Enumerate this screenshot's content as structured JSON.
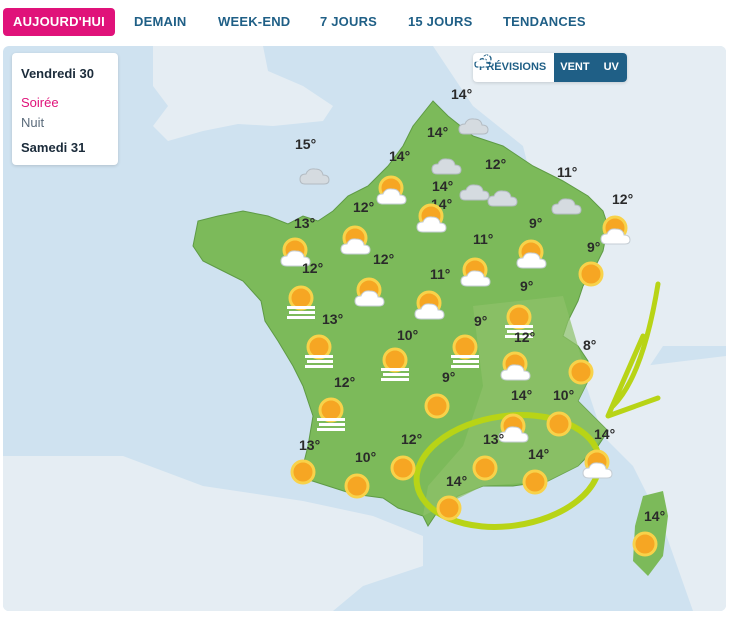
{
  "tabs": [
    {
      "label": "AUJOURD'HUI",
      "active": true
    },
    {
      "label": "DEMAIN",
      "active": false
    },
    {
      "label": "WEEK-END",
      "active": false
    },
    {
      "label": "7 JOURS",
      "active": false
    },
    {
      "label": "15 JOURS",
      "active": false
    },
    {
      "label": "TENDANCES",
      "active": false
    }
  ],
  "day_selector": {
    "day1": "Vendredi 30",
    "evening": "Soirée",
    "night": "Nuit",
    "day2": "Samedi 31"
  },
  "layers": [
    {
      "label": "PRÉVISIONS",
      "icon": "cloud-sun-icon",
      "active": false
    },
    {
      "label": "VENT",
      "icon": "wind-icon",
      "active": true
    },
    {
      "label": "UV",
      "icon": "uv-icon",
      "active": false
    }
  ],
  "colors": {
    "accent": "#e0127a",
    "nav": "#1f5f86",
    "land": "#7cba5a",
    "sea": "#cfe2f0",
    "annotation": "#b8d416"
  },
  "stations": [
    {
      "temp": "14°",
      "icon": "cloud-icon"
    },
    {
      "temp": "14°",
      "icon": "cloud-icon"
    },
    {
      "temp": "15°",
      "icon": "cloud-icon"
    },
    {
      "temp": "14°",
      "icon": "sun-cloud-icon"
    },
    {
      "temp": "12°",
      "icon": "cloud-icon"
    },
    {
      "temp": "11°",
      "icon": "cloud-icon"
    },
    {
      "temp": "14°",
      "icon": "cloud-icon"
    },
    {
      "temp": "14°",
      "icon": "sun-cloud-icon"
    },
    {
      "temp": "13°",
      "icon": "sun-cloud-icon"
    },
    {
      "temp": "12°",
      "icon": "sun-cloud-icon"
    },
    {
      "temp": "12°",
      "icon": "sun-cloud-icon"
    },
    {
      "temp": "9°",
      "icon": "sun-cloud-icon"
    },
    {
      "temp": "11°",
      "icon": "sun-cloud-icon"
    },
    {
      "temp": "9°",
      "icon": "sun-icon"
    },
    {
      "temp": "12°",
      "icon": "sun-fog-icon"
    },
    {
      "temp": "12°",
      "icon": "sun-cloud-icon"
    },
    {
      "temp": "11°",
      "icon": "sun-cloud-icon"
    },
    {
      "temp": "9°",
      "icon": "sun-fog-icon"
    },
    {
      "temp": "13°",
      "icon": "sun-fog-icon"
    },
    {
      "temp": "10°",
      "icon": "sun-fog-icon"
    },
    {
      "temp": "9°",
      "icon": "sun-fog-icon"
    },
    {
      "temp": "12°",
      "icon": "sun-cloud-icon"
    },
    {
      "temp": "8°",
      "icon": "sun-icon"
    },
    {
      "temp": "12°",
      "icon": "sun-fog-icon"
    },
    {
      "temp": "9°",
      "icon": "sun-icon"
    },
    {
      "temp": "14°",
      "icon": "sun-cloud-icon"
    },
    {
      "temp": "10°",
      "icon": "sun-icon"
    },
    {
      "temp": "13°",
      "icon": "sun-icon"
    },
    {
      "temp": "12°",
      "icon": "sun-icon"
    },
    {
      "temp": "13°",
      "icon": "sun-icon"
    },
    {
      "temp": "14°",
      "icon": "sun-cloud-icon"
    },
    {
      "temp": "10°",
      "icon": "sun-icon"
    },
    {
      "temp": "14°",
      "icon": "sun-icon"
    },
    {
      "temp": "14°",
      "icon": "sun-icon"
    },
    {
      "temp": "14°",
      "icon": "sun-icon"
    }
  ]
}
